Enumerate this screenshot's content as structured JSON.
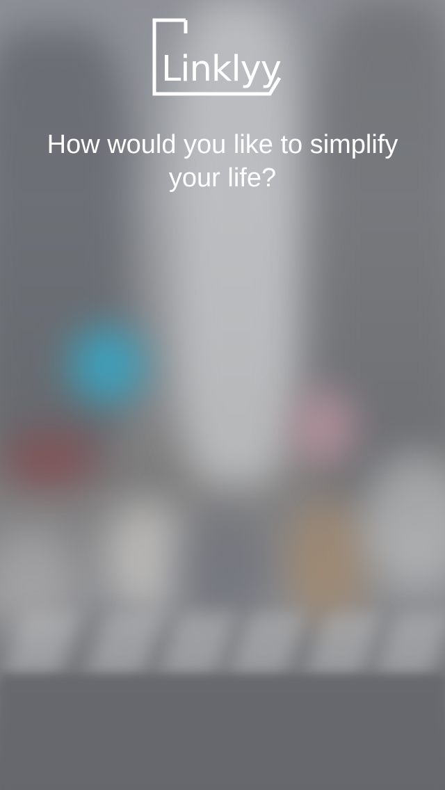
{
  "brand": {
    "name": "Linklyy"
  },
  "onboarding": {
    "question": "How would you like to simplify your life?"
  },
  "background": {
    "description_icon": "blurred-street-photo"
  }
}
